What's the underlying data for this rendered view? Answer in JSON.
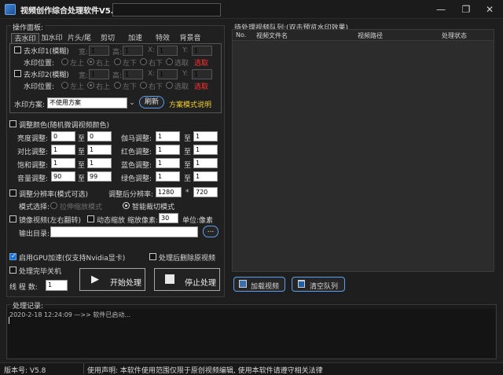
{
  "window": {
    "title": "视频创作综合处理软件V5.8",
    "title_input_value": "",
    "controls": {
      "minimize": "—",
      "restore": "❐",
      "close": "✕"
    }
  },
  "left_panel": {
    "title": "操作面板:",
    "tabs": [
      "去水印",
      "加水印",
      "片头/尾",
      "剪切",
      "加速",
      "特效",
      "背景音"
    ],
    "active_tab": "去水印",
    "watermark1": {
      "label": "去水印1(模糊)",
      "width_label": "宽:",
      "width_value": "1",
      "height_label": "高:",
      "height_value": "1",
      "x_label": "X:",
      "x_value": "1",
      "y_label": "Y:",
      "y_value": "1",
      "pos_label": "水印位置:",
      "positions": [
        "左上",
        "右上",
        "左下",
        "右下",
        "选取"
      ],
      "selected_position": "右上",
      "select_label": "选取"
    },
    "watermark2": {
      "label": "去水印2(模糊)",
      "width_label": "宽:",
      "width_value": "1",
      "height_label": "高:",
      "height_value": "1",
      "x_label": "X:",
      "x_value": "1",
      "y_label": "Y:",
      "y_value": "1",
      "pos_label": "水印位置:",
      "positions": [
        "左上",
        "右上",
        "左下",
        "右下",
        "选取"
      ],
      "selected_position": "右上",
      "select_label": "选取"
    },
    "scheme": {
      "label": "水印方案:",
      "value": "不使用方案",
      "refresh_label": "刷新",
      "help_label": "方案模式说明"
    },
    "color": {
      "label": "调整颜色(随机微调视频颜色)",
      "to": "至",
      "rows": [
        {
          "left_label": "亮度调整:",
          "left_from": "0",
          "left_to": "0",
          "right_label": "伽马调整:",
          "right_from": "1",
          "right_to": "1"
        },
        {
          "left_label": "对比调整:",
          "left_from": "1",
          "left_to": "1",
          "right_label": "红色调整:",
          "right_from": "1",
          "right_to": "1"
        },
        {
          "left_label": "饱和调整:",
          "left_from": "1",
          "left_to": "1",
          "right_label": "蓝色调整:",
          "right_from": "1",
          "right_to": "1"
        },
        {
          "left_label": "音量调整:",
          "left_from": "90",
          "left_to": "99",
          "right_label": "绿色调整:",
          "right_from": "1",
          "right_to": "1"
        }
      ]
    },
    "resolution": {
      "label": "调整分辨率(模式可选)",
      "after_label": "调整后分辨率:",
      "width": "1280",
      "times": "*",
      "height": "720",
      "mode_label": "模式选择:",
      "mode_stretch": "拉伸缩放模式",
      "mode_smart": "智能裁切模式"
    },
    "mirror": {
      "label": "镜像视频(左右翻转)",
      "zoom_label": "动态缩放",
      "pixels_label": "缩放像素:",
      "pixels_value": "30",
      "unit_label": "单位:像素"
    },
    "output": {
      "label": "输出目录:",
      "value": "",
      "browse_label": "..."
    },
    "gpu": {
      "label": "启用GPU加速(仅支持Nvidia显卡)",
      "delete_label": "处理后删除原视频",
      "shutdown_label": "处理完毕关机",
      "threads_label": "线 程 数:",
      "threads_value": "1",
      "start_label": "开始处理",
      "stop_label": "停止处理"
    }
  },
  "right_panel": {
    "title": "待处理视频队列:(双击预览水印效果)",
    "columns": [
      "No.",
      "视频文件名",
      "视频路径",
      "处理状态"
    ],
    "load_label": "加载视频",
    "clear_label": "清空队列"
  },
  "log": {
    "title": "处理记录:",
    "lines": [
      "2020-2-18 12:24:09 —>> 软件已启动..."
    ]
  },
  "status_bar": {
    "version": "版本号: V5.8",
    "notice": "使用声明: 本软件使用范围仅限于原创视频编辑, 使用本软件请遵守相关法律"
  },
  "colors": {
    "background": "#1e1e1e",
    "panel_border": "#3a3a3a",
    "accent_red": "#ff3030",
    "accent_yellow": "#f0d030",
    "checkbox_checked": "#1f6fd0"
  }
}
